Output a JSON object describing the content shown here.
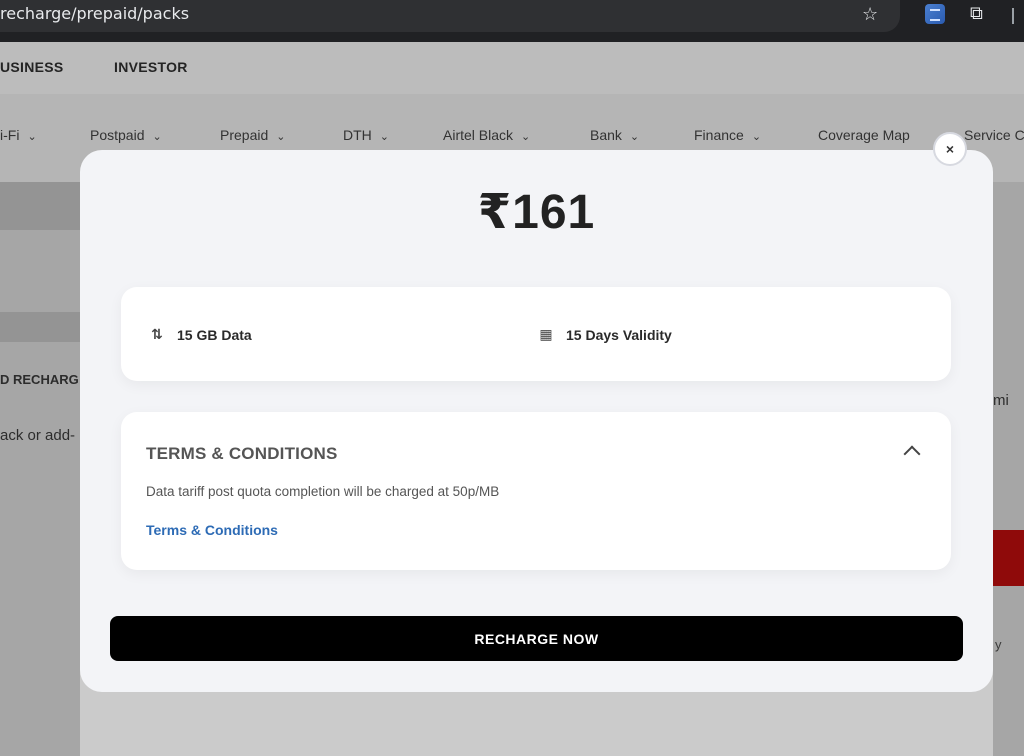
{
  "browser": {
    "url": "recharge/prepaid/packs",
    "star_icon": "star-icon",
    "extension_icon": "translate-extension-icon",
    "puzzle_icon": "extensions-puzzle-icon"
  },
  "header": {
    "top_links": [
      "USINESS",
      "INVESTOR"
    ]
  },
  "nav": {
    "items": [
      {
        "label": "i-Fi"
      },
      {
        "label": "Postpaid"
      },
      {
        "label": "Prepaid"
      },
      {
        "label": "DTH"
      },
      {
        "label": "Airtel Black"
      },
      {
        "label": "Bank"
      },
      {
        "label": "Finance"
      },
      {
        "label": "Coverage Map"
      },
      {
        "label": "Service C"
      }
    ]
  },
  "background": {
    "left_heading": "D RECHARG",
    "left_input_text": "ack or add-",
    "right_text_1": "mi",
    "right_text_2": "y"
  },
  "modal": {
    "close_label": "×",
    "price": "₹161",
    "benefits": [
      {
        "icon": "data-arrows-icon",
        "glyph": "⇅",
        "label": "15 GB Data"
      },
      {
        "icon": "calendar-icon",
        "glyph": "▦",
        "label": "15 Days Validity"
      }
    ],
    "terms": {
      "title": "TERMS & CONDITIONS",
      "description": "Data tariff post quota completion will be charged at 50p/MB",
      "link_label": "Terms & Conditions"
    },
    "cta_label": "RECHARGE NOW"
  },
  "colors": {
    "cta_background": "#000000",
    "link": "#2d6bb5",
    "brand_red": "#a30c0c"
  }
}
